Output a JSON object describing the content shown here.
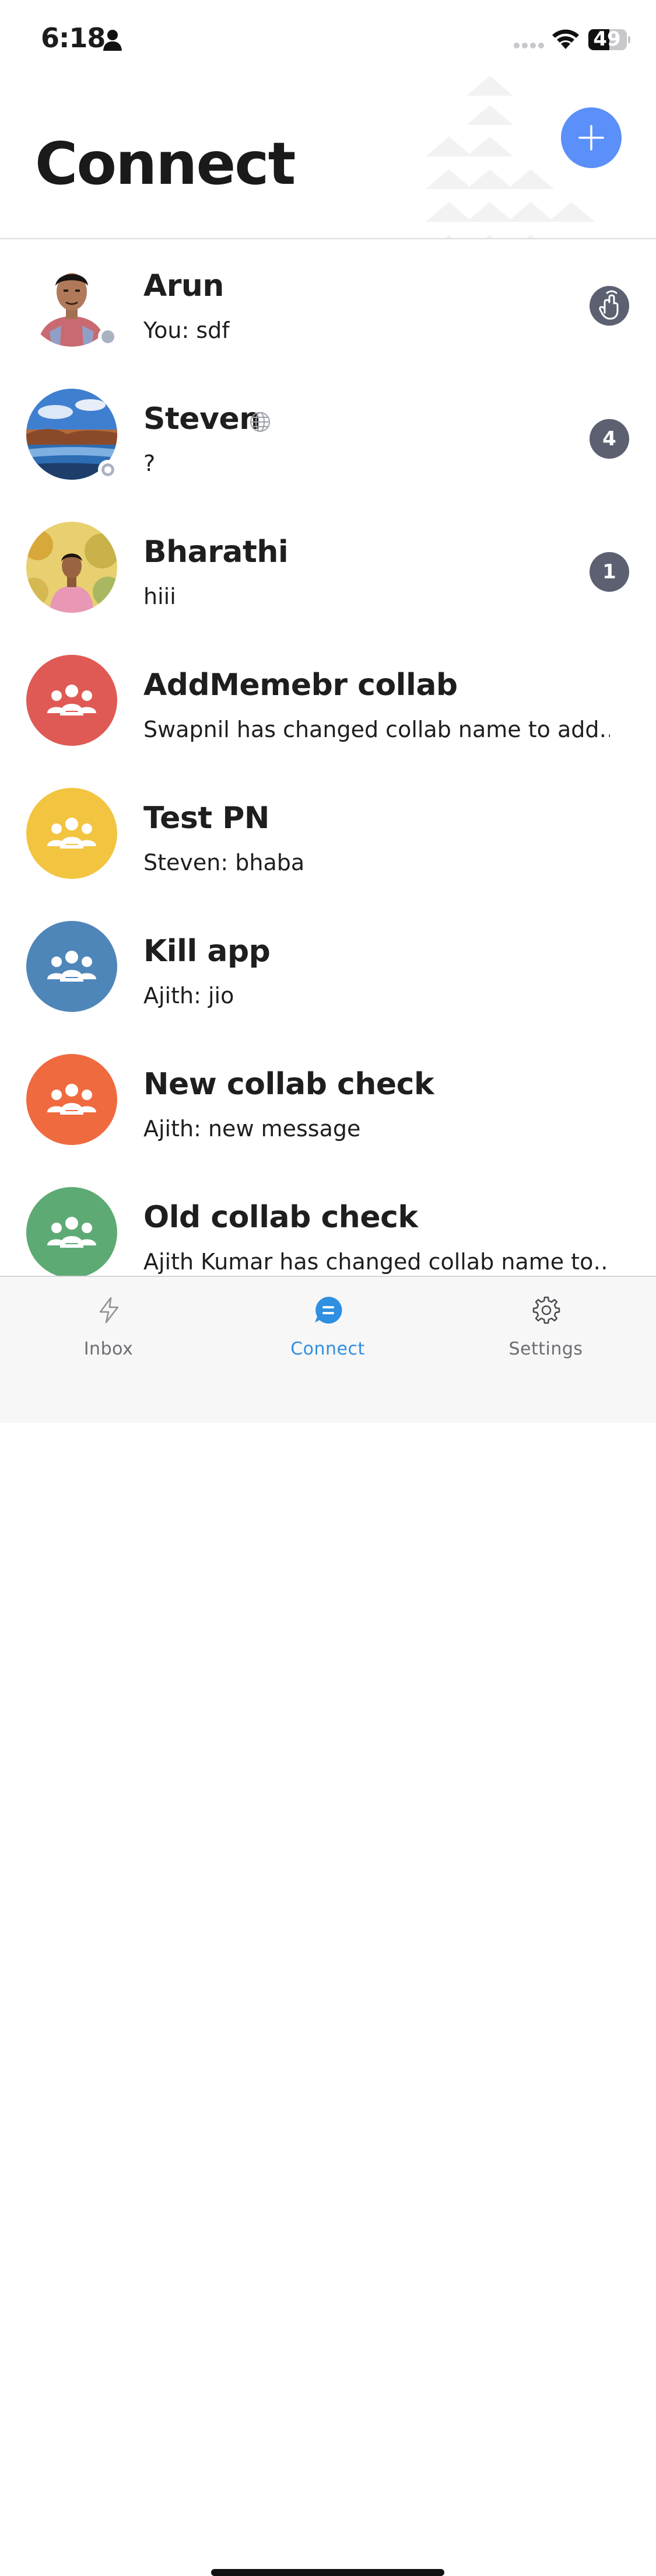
{
  "status_bar": {
    "time": "6:18",
    "battery": "49",
    "icons": [
      "person-icon",
      "signal-icon",
      "wifi-icon",
      "battery-icon"
    ]
  },
  "header": {
    "title": "Connect",
    "add_icon": "plus-icon",
    "accent_color": "#5b8ff9"
  },
  "conversations": [
    {
      "name": "Arun",
      "preview": "You: sdf",
      "avatar": "photo",
      "presence": "offline",
      "badge_icon": "wave-icon"
    },
    {
      "name": "Steven",
      "preview": "?",
      "avatar": "photo",
      "presence": "away",
      "name_icon": "globe-icon",
      "badge": "4"
    },
    {
      "name": "Bharathi",
      "preview": "hiii",
      "avatar": "photo",
      "badge": "1"
    },
    {
      "name": "AddMemebr collab",
      "preview": "Swapnil has changed collab name to add…",
      "avatar": "group-icon",
      "color": "#df5a54"
    },
    {
      "name": "Test PN",
      "preview": "Steven: bhaba",
      "avatar": "group-icon",
      "color": "#f2c440"
    },
    {
      "name": "Kill app",
      "preview": "Ajith: jio",
      "avatar": "group-icon",
      "color": "#4f86ba"
    },
    {
      "name": "New collab check",
      "preview": "Ajith: new message",
      "avatar": "group-icon",
      "color": "#ef6a3f"
    },
    {
      "name": "Old collab check",
      "preview": "Ajith Kumar has changed collab name to…",
      "avatar": "group-icon",
      "color": "#5daa74"
    }
  ],
  "tabs": [
    {
      "label": "Inbox",
      "icon": "lightning-icon",
      "active": false
    },
    {
      "label": "Connect",
      "icon": "chat-bubble-icon",
      "active": true
    },
    {
      "label": "Settings",
      "icon": "gear-icon",
      "active": false
    }
  ],
  "colors": {
    "active_tab": "#2f8fe0",
    "badge": "#5c6070"
  }
}
